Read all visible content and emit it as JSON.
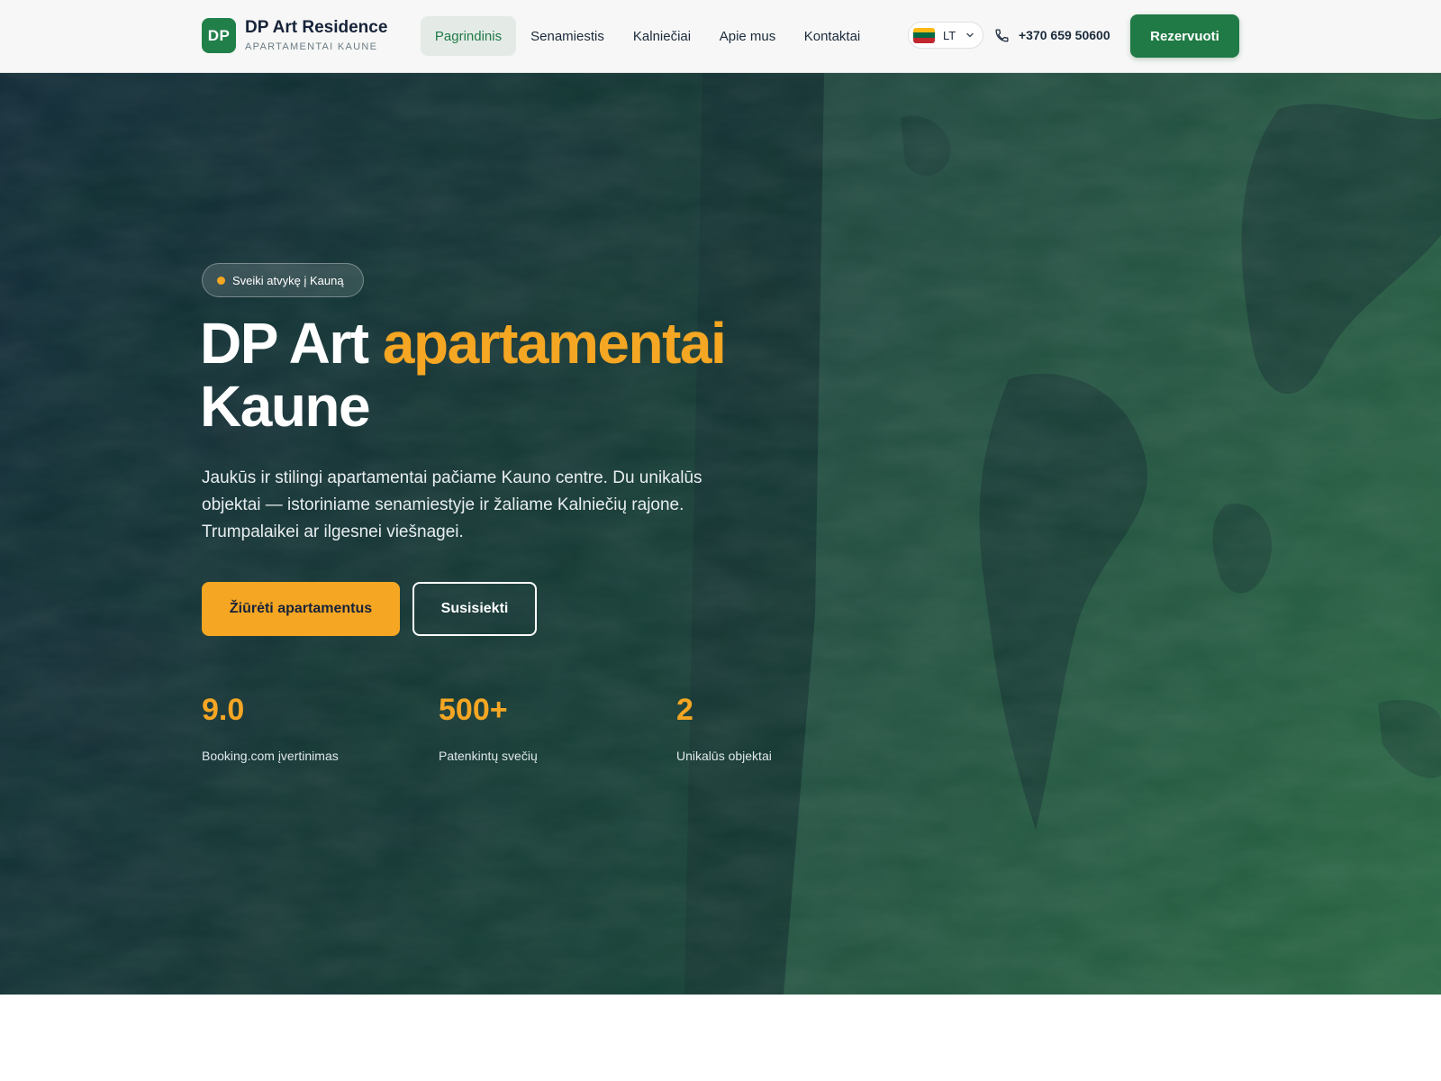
{
  "brand": {
    "logo_text": "DP",
    "name": "DP Art Residence",
    "subtitle": "APARTAMENTAI KAUNE",
    "color": "#21804a"
  },
  "nav": {
    "items": [
      {
        "label": "Pagrindinis",
        "active": true
      },
      {
        "label": "Senamiestis",
        "active": false
      },
      {
        "label": "Kalniečiai",
        "active": false
      },
      {
        "label": "Apie mus",
        "active": false
      },
      {
        "label": "Kontaktai",
        "active": false
      }
    ]
  },
  "language": {
    "selected": "LT",
    "flag_colors": [
      "#fdb913",
      "#006a44",
      "#c1272d"
    ]
  },
  "contact": {
    "phone": "+370 659 50600",
    "icon": "phone-icon"
  },
  "header_cta": {
    "label": "Rezervuoti"
  },
  "hero": {
    "badge": "Sveiki atvykę į Kauną",
    "title_main": "DP Art ",
    "title_accent": "apartamentai",
    "title_end": "Kaune",
    "description": "Jaukūs ir stilingi apartamentai pačiame Kauno centre. Du unikalūs objektai — istoriniame senamiestyje ir žaliame Kalniečių rajone. Trumpalaikei ar ilgesnei viešnagei.",
    "primary_button": "Žiūrėti apartamentus",
    "secondary_button": "Susisiekti",
    "accent_color": "#f5a623"
  },
  "stats": [
    {
      "value": "9.0",
      "label": "Booking.com įvertinimas"
    },
    {
      "value": "500+",
      "label": "Patenkintų svečių"
    },
    {
      "value": "2",
      "label": "Unikalūs objektai"
    }
  ]
}
